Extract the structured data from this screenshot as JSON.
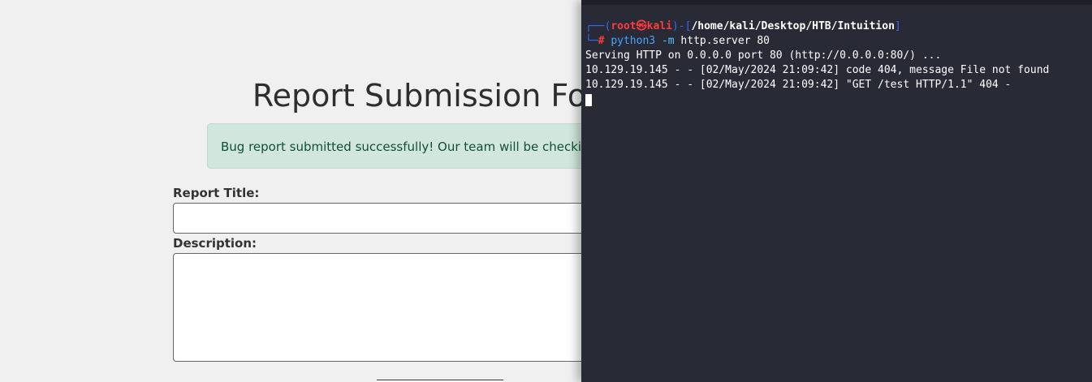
{
  "webpage": {
    "title": "Report Submission Form",
    "alert_message": "Bug report submitted successfully! Our team will be checking on this shortly.",
    "report_title_label": "Report Title:",
    "report_title_value": "",
    "description_label": "Description:",
    "description_value": ""
  },
  "terminal": {
    "prompt": {
      "bracket_left": "┌──(",
      "user": "root",
      "at_symbol": "㉿",
      "host": "kali",
      "bracket_mid": ")-[",
      "cwd": "/home/kali/Desktop/HTB/Intuition",
      "bracket_right": "]",
      "line2_prefix": "└─",
      "hash": "#",
      "command": "python3",
      "flag": "-m",
      "args": "http.server 80"
    },
    "output": [
      "Serving HTTP on 0.0.0.0 port 80 (http://0.0.0.0:80/) ...",
      "10.129.19.145 - - [02/May/2024 21:09:42] code 404, message File not found",
      "10.129.19.145 - - [02/May/2024 21:09:42] \"GET /test HTTP/1.1\" 404 -"
    ]
  }
}
